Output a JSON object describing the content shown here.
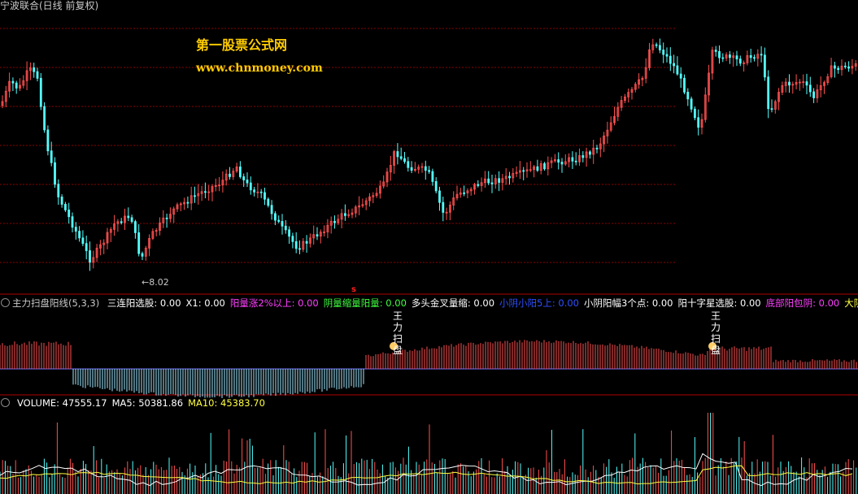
{
  "title": "宁波联合(日线 前复权)",
  "watermark": {
    "line1": "第一股票公式网",
    "line2": "www.chnmoney.com"
  },
  "price_panel": {
    "low_label": "←8.02",
    "marker": "s"
  },
  "indicator_panel": {
    "name": "主力扫盘阳线(5,3,3)",
    "items": [
      {
        "label": "三连阳选股: 0.00",
        "color": "#ffffff"
      },
      {
        "label": "X1: 0.00",
        "color": "#ffffff"
      },
      {
        "label": "阳量涨2%以上: 0.00",
        "color": "#ff40ff"
      },
      {
        "label": "阴量缩量阳量: 0.00",
        "color": "#40ff40"
      },
      {
        "label": "多头金叉量缩: 0.00",
        "color": "#ffffff"
      },
      {
        "label": "小阴小阳5上: 0.00",
        "color": "#3050ff"
      },
      {
        "label": "小阴阳幅3个点: 0.00",
        "color": "#ffffff"
      },
      {
        "label": "阳十字星选股: 0.00",
        "color": "#ffffff"
      },
      {
        "label": "底部阳包阴: 0.00",
        "color": "#ff40ff"
      },
      {
        "label": "大阴后",
        "color": "#ffff40"
      }
    ],
    "signal_text": "王力扫盘",
    "signal_chars": [
      "王",
      "力",
      "扫",
      "盘"
    ]
  },
  "volume_panel": {
    "items": [
      {
        "label": "VOLUME: 47555.17",
        "color": "#ffffff"
      },
      {
        "label": "MA5: 50381.86",
        "color": "#ffffff"
      },
      {
        "label": "MA10: 45383.70",
        "color": "#ffff40"
      }
    ]
  },
  "colors": {
    "up": "#ff5050",
    "down": "#54ffff",
    "grid": "#8b0000",
    "panel_border": "#b00000"
  }
}
